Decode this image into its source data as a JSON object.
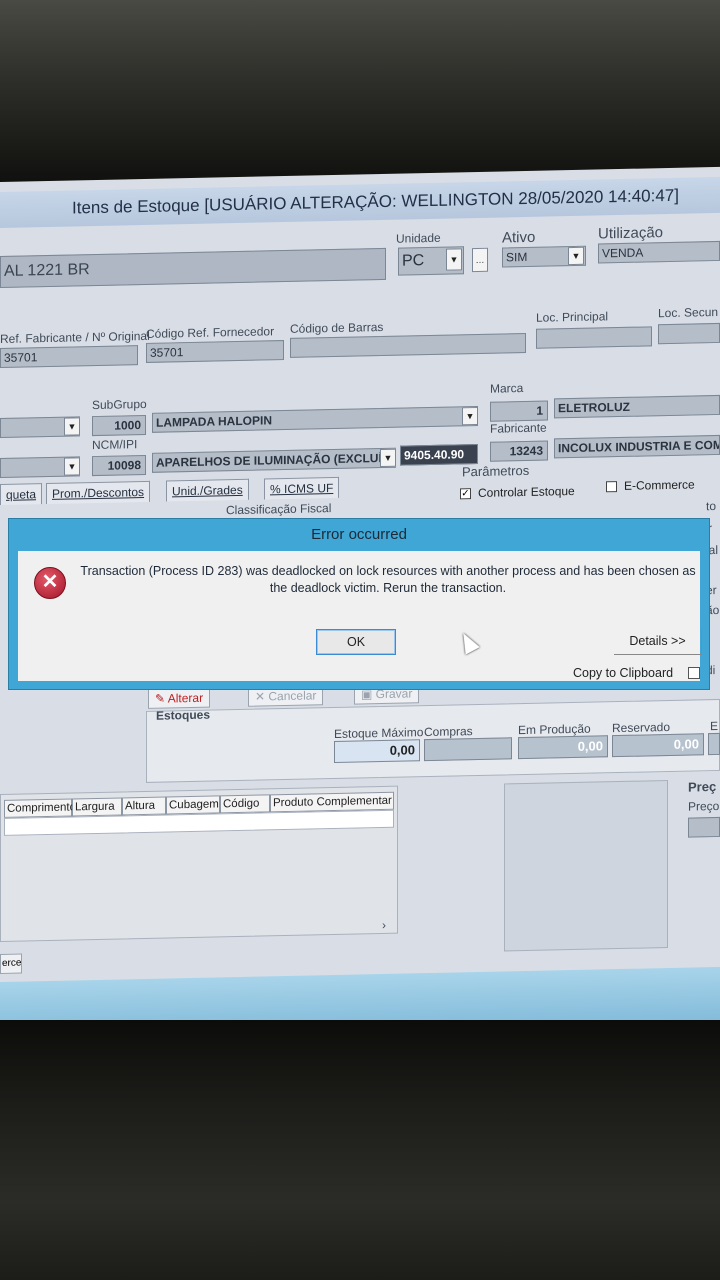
{
  "window": {
    "title": "Itens de Estoque  [USUÁRIO ALTERAÇÃO: WELLINGTON 28/05/2020 14:40:47]"
  },
  "header": {
    "descricao_value": "AL 1221 BR",
    "unidade_label": "Unidade",
    "unidade_value": "PC",
    "ativo_label": "Ativo",
    "ativo_value": "SIM",
    "utilizacao_label": "Utilização",
    "utilizacao_value": "VENDA"
  },
  "refs": {
    "ref_fabricante_label": "Ref. Fabricante / Nº Original",
    "ref_fabricante_value": "35701",
    "cod_fornecedor_label": "Código Ref. Fornecedor",
    "cod_fornecedor_value": "35701",
    "cod_barras_label": "Código de Barras",
    "loc_principal_label": "Loc. Principal",
    "loc_secundaria_label": "Loc. Secun"
  },
  "classif": {
    "subgrupo_label": "SubGrupo",
    "subgrupo_code": "1000",
    "subgrupo_name": "LAMPADA HALOPIN",
    "ncm_label": "NCM/IPI",
    "ncm_code": "10098",
    "ncm_name": "APARELHOS DE ILUMINAÇÃO (EXCLUÍD",
    "ncm_number": "9405.40.90",
    "marca_label": "Marca",
    "marca_code": "1",
    "marca_name": "ELETROLUZ",
    "fabricante_label": "Fabricante",
    "fabricante_code": "13243",
    "fabricante_name": "INCOLUX INDUSTRIA E COM"
  },
  "tabs": [
    "queta",
    "Prom./Descontos",
    "Unid./Grades",
    "% ICMS UF"
  ],
  "classificacao_fiscal_label": "Classificação Fiscal",
  "parametros": {
    "title": "Parâmetros",
    "controlar_estoque": "Controlar Estoque",
    "ecommerce": "E-Commerce"
  },
  "actions": {
    "alterar": "Alterar",
    "cancelar": "Cancelar",
    "gravar": "Gravar"
  },
  "estoques": {
    "title": "Estoques",
    "estoque_maximo_label": "Estoque Máximo",
    "estoque_maximo_value": "0,00",
    "compras_label": "Compras",
    "em_producao_label": "Em Produção",
    "em_producao_value": "0,00",
    "reservado_label": "Reservado",
    "reservado_value": "0,00",
    "cut_label": "E"
  },
  "grid": {
    "columns": [
      "Comprimento",
      "Largura",
      "Altura",
      "Cubagem",
      "Código",
      "Produto Complementar"
    ]
  },
  "preco": {
    "title": "Preç",
    "sub": "Preço"
  },
  "bottom_tab": "erce",
  "side_fragments": [
    "to",
    "r",
    "ial",
    "er",
    "ão",
    "di"
  ],
  "dialog": {
    "title": "Error occurred",
    "message": "Transaction (Process ID 283) was deadlocked on lock resources with another process and has been chosen as the deadlock victim. Rerun the transaction.",
    "ok": "OK",
    "details": "Details >>",
    "copy": "Copy to Clipboard"
  }
}
